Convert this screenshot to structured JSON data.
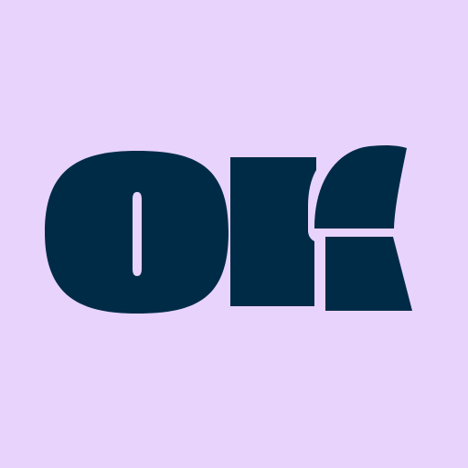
{
  "logo": {
    "wordmark": "ok",
    "icon": "ok-wordmark-logo"
  },
  "colors": {
    "background": "#E8D3FD",
    "logo": "#002B47"
  }
}
